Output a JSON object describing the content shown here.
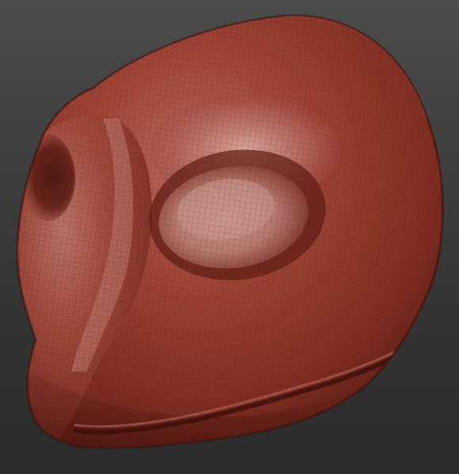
{
  "scene": {
    "subject": "sculpted-head-model",
    "background_top": "#4b4b4b",
    "background_bottom": "#2a2a2a",
    "material_base": "#8f3a2c",
    "material_highlight": "#c58b82",
    "material_shadow": "#4a1510",
    "wireframe_color": "#5a1f16"
  }
}
